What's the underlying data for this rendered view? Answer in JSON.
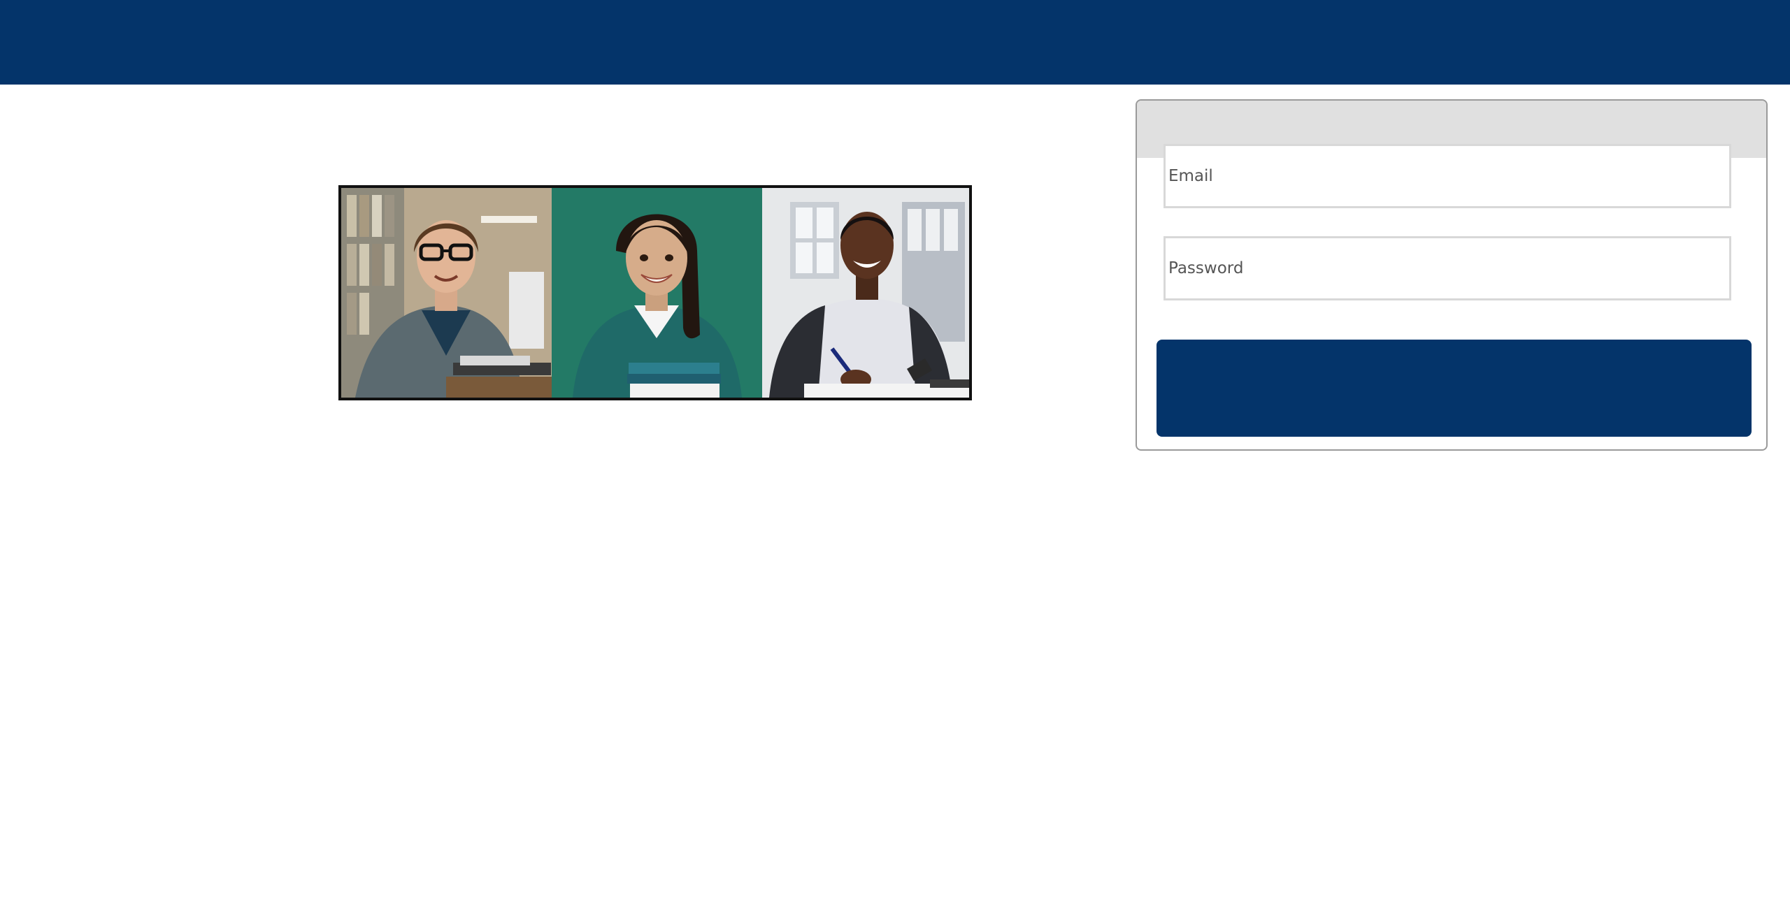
{
  "colors": {
    "brand": "#04346a",
    "panel_header": "#e0e0e0",
    "field_border": "#d8d8d8"
  },
  "hero": {
    "photos": [
      {
        "icon": "student-laptop-photo"
      },
      {
        "icon": "student-books-photo"
      },
      {
        "icon": "student-writing-photo"
      }
    ]
  },
  "login": {
    "email_placeholder": "Email",
    "password_placeholder": "Password",
    "submit_label": ""
  }
}
